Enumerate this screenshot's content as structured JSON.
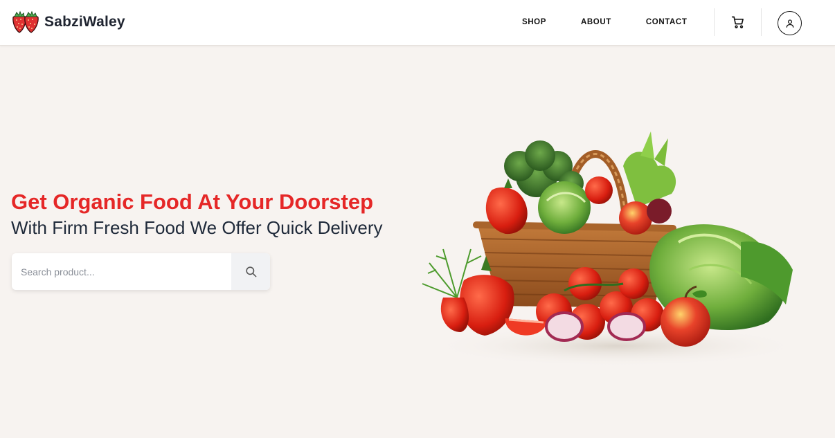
{
  "brand": {
    "name": "SabziWaley",
    "logo_icon": "strawberry-icon"
  },
  "nav": {
    "links": [
      {
        "label": "SHOP"
      },
      {
        "label": "ABOUT"
      },
      {
        "label": "CONTACT"
      }
    ],
    "cart_icon": "cart-icon",
    "account_icon": "user-icon"
  },
  "hero": {
    "title": "Get Organic Food At Your Doorstep",
    "subtitle": "With Firm Fresh Food We Offer Quick Delivery",
    "search": {
      "placeholder": "Search product...",
      "value": "",
      "button_icon": "search-icon"
    },
    "image_icon": "vegetable-basket-icon"
  },
  "colors": {
    "accent": "#e52727",
    "page_bg": "#f7f3f0",
    "nav_bg": "#ffffff",
    "text_dark": "#1f2a3a"
  }
}
